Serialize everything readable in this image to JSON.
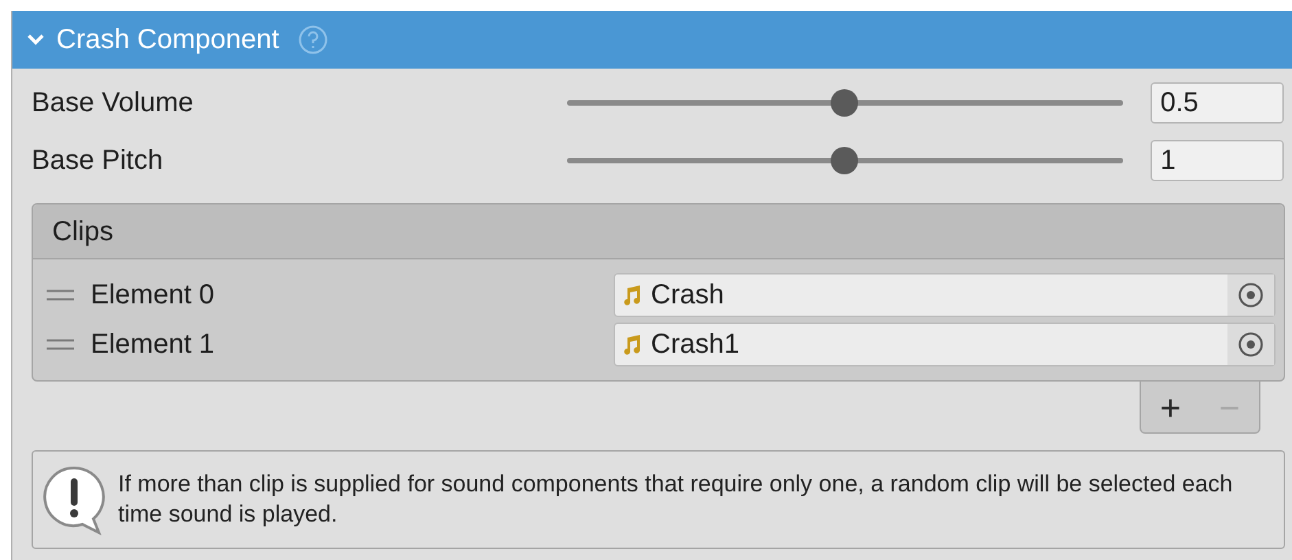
{
  "component": {
    "title": "Crash Component",
    "expanded": true
  },
  "properties": [
    {
      "label": "Base Volume",
      "level": 0.5,
      "value": "0.5"
    },
    {
      "label": "Base Pitch",
      "level": 0.5,
      "value": "1"
    }
  ],
  "clips": {
    "title": "Clips",
    "elements": [
      {
        "label": "Element 0",
        "value": "Crash"
      },
      {
        "label": "Element 1",
        "value": "Crash1"
      }
    ],
    "buttons": [
      {
        "label": "+",
        "disabled": false
      },
      {
        "label": "−",
        "disabled": true
      }
    ]
  },
  "help": {
    "message": "If more than clip is supplied for sound components that require only one, a random clip will be selected each time sound is played."
  }
}
